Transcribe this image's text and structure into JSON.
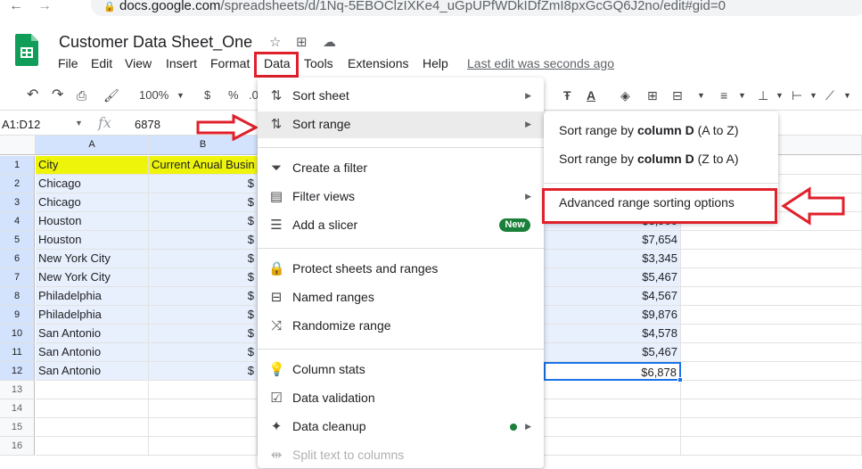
{
  "browser": {
    "url_host": "docs.google.com",
    "url_path": "/spreadsheets/d/1Nq-5EBOClzIXKe4_uGpUPfWDkIDfZmI8pxGcGQ6J2no/edit#gid=0"
  },
  "doc": {
    "title": "Customer Data Sheet_One",
    "last_edit": "Last edit was seconds ago"
  },
  "menubar": [
    "File",
    "Edit",
    "View",
    "Insert",
    "Format",
    "Data",
    "Tools",
    "Extensions",
    "Help"
  ],
  "toolbar": {
    "zoom": "100%",
    "currency": "$",
    "percent": "%",
    "decimal": ".0"
  },
  "formula_bar": {
    "name_box": "A1:D12",
    "fx": "fx",
    "value": "6878"
  },
  "grid": {
    "col_a": "A",
    "col_b": "B",
    "rows": [
      "1",
      "2",
      "3",
      "4",
      "5",
      "6",
      "7",
      "8",
      "9",
      "10",
      "11",
      "12",
      "13",
      "14",
      "15",
      "16"
    ],
    "header_a": "City",
    "header_b": "Current Anual Busin",
    "cities": [
      "Chicago",
      "Chicago",
      "Houston",
      "Houston",
      "New York City",
      "New York City",
      "Philadelphia",
      "Philadelphia",
      "San Antonio",
      "San Antonio",
      "San Antonio"
    ],
    "col_b_partial": [
      "$",
      "$",
      "$",
      "$",
      "$",
      "$",
      "$",
      "$",
      "$",
      "$",
      "$"
    ],
    "col_d_visible": [
      {
        "row": "4",
        "value": "$3,900"
      },
      {
        "row": "5",
        "value": "$7,654"
      },
      {
        "row": "6",
        "value": "$3,345"
      },
      {
        "row": "7",
        "value": "$5,467"
      },
      {
        "row": "8",
        "value": "$4,567"
      },
      {
        "row": "9",
        "value": "$9,876"
      },
      {
        "row": "10",
        "value": "$4,578"
      },
      {
        "row": "11",
        "value": "$5,467"
      },
      {
        "row": "12",
        "value": "$6,878"
      }
    ]
  },
  "data_menu": {
    "sort_sheet": "Sort sheet",
    "sort_range": "Sort range",
    "create_filter": "Create a filter",
    "filter_views": "Filter views",
    "add_slicer": "Add a slicer",
    "new_badge": "New",
    "protect": "Protect sheets and ranges",
    "named_ranges": "Named ranges",
    "randomize": "Randomize range",
    "column_stats": "Column stats",
    "data_validation": "Data validation",
    "data_cleanup": "Data cleanup",
    "split_text": "Split text to columns"
  },
  "sort_submenu": {
    "az_prefix": "Sort range by ",
    "az_col": "column D",
    "az_suffix": " (A to Z)",
    "za_prefix": "Sort range by ",
    "za_col": "column D",
    "za_suffix": " (Z to A)",
    "advanced": "Advanced range sorting options"
  },
  "colors": {
    "annotation_red": "#e0202b",
    "sheets_green": "#188038",
    "header_yellow": "#eef50a",
    "selection_blue": "#e8f0fe"
  }
}
